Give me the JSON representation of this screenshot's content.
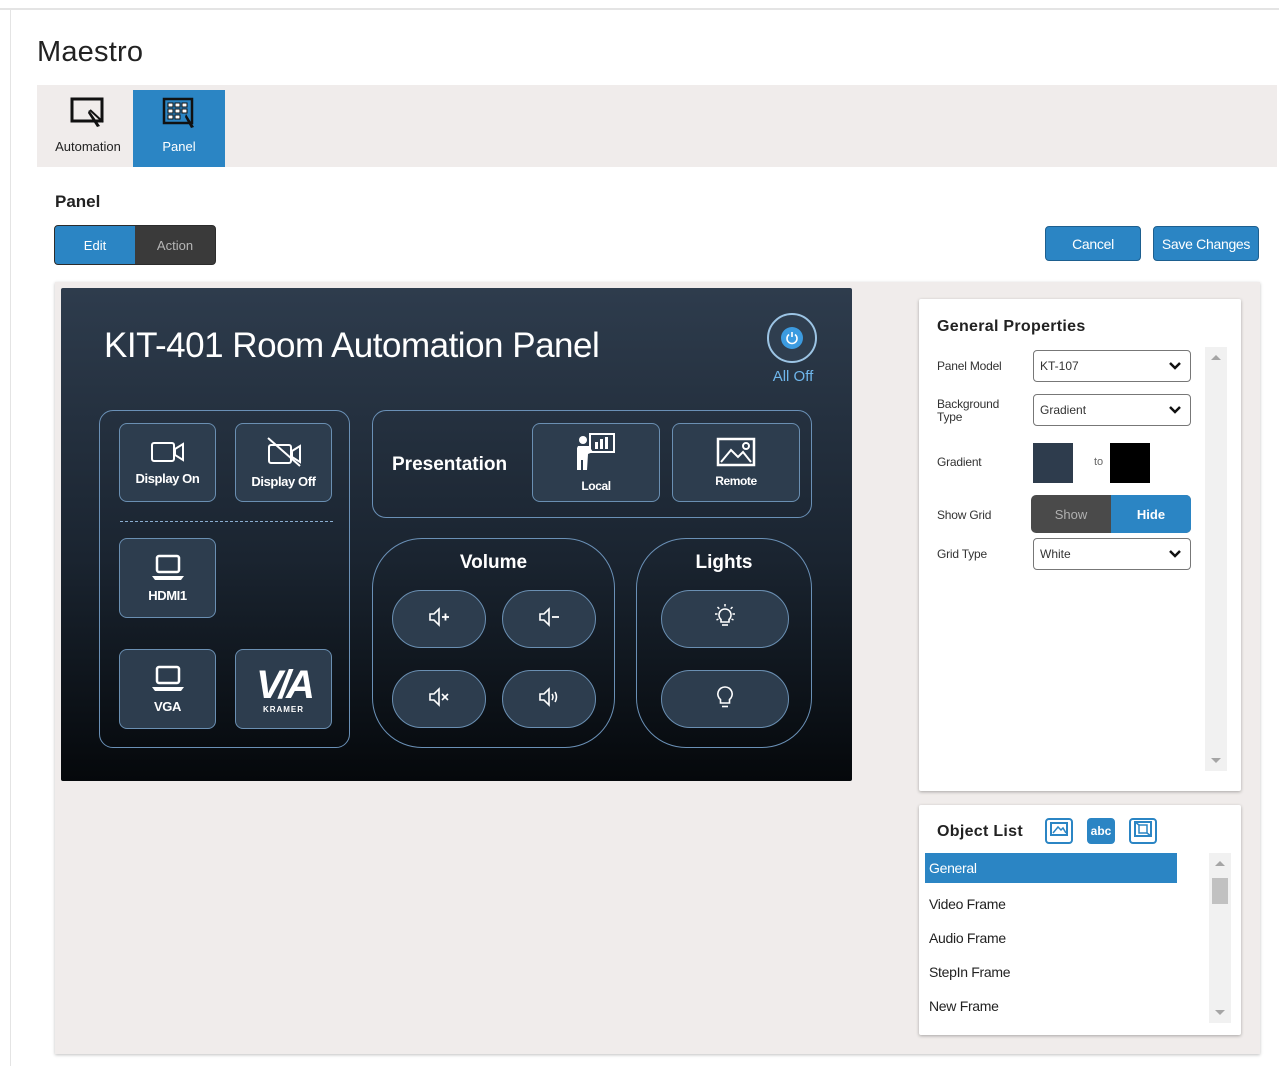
{
  "app": {
    "title": "Maestro"
  },
  "tabs": [
    {
      "label": "Automation",
      "icon": "automation-icon",
      "active": false
    },
    {
      "label": "Panel",
      "icon": "panel-grid-icon",
      "active": true
    }
  ],
  "section": {
    "title": "Panel"
  },
  "mode_toggle": {
    "options": [
      "Edit",
      "Action"
    ],
    "selected": "Edit"
  },
  "actions": {
    "cancel": "Cancel",
    "save": "Save Changes"
  },
  "preview": {
    "title": "KIT-401 Room Automation Panel",
    "all_off": "All Off",
    "buttons": {
      "display_on": "Display On",
      "display_off": "Display Off",
      "hdmi1": "HDMI1",
      "vga": "VGA",
      "via_logo_main": "V/A",
      "via_logo_sub": "KRAMER"
    },
    "presentation": {
      "label": "Presentation",
      "local": "Local",
      "remote": "Remote"
    },
    "volume": {
      "title": "Volume",
      "buttons": [
        "volume-up-icon",
        "volume-down-icon",
        "mute-icon",
        "volume-loud-icon"
      ]
    },
    "lights": {
      "title": "Lights",
      "buttons": [
        "light-on-icon",
        "light-off-icon"
      ]
    },
    "colors": {
      "gradient_from": "#2e3c4d",
      "gradient_to": "#000000",
      "accent": "#2b85c4",
      "power": "#3c9be0"
    }
  },
  "general_properties": {
    "title": "General Properties",
    "panel_model": {
      "label": "Panel Model",
      "value": "KT-107"
    },
    "background_type": {
      "label": "Background Type",
      "value": "Gradient"
    },
    "gradient": {
      "label": "Gradient",
      "to_label": "to",
      "from_color": "#2e3c4d",
      "to_color": "#000000"
    },
    "show_grid": {
      "label": "Show Grid",
      "options": [
        "Show",
        "Hide"
      ],
      "selected": "Hide"
    },
    "grid_type": {
      "label": "Grid Type",
      "value": "White"
    }
  },
  "object_list": {
    "title": "Object List",
    "tools": [
      "image-icon",
      "text-abc-icon",
      "frame-icon"
    ],
    "items": [
      "General",
      "Video Frame",
      "Audio Frame",
      "StepIn Frame",
      "New Frame"
    ],
    "selected": "General"
  }
}
